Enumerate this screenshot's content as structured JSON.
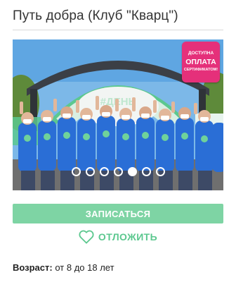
{
  "header": {
    "title": "Путь добра (Клуб \"Кварц\")"
  },
  "gallery": {
    "badge": {
      "line1": "ДОСТУПНА",
      "line2": "ОПЛАТА",
      "line3": "СЕРТИФИКАТОМ!"
    },
    "slide_count": 7,
    "active_slide": 5,
    "banner_text": "#ДЕНЬ"
  },
  "actions": {
    "signup_label": "ЗАПИСАТЬСЯ",
    "later_label": "ОТЛОЖИТЬ"
  },
  "info": {
    "age_label": "Возраст:",
    "age_value": "от 8 до 18 лет"
  },
  "colors": {
    "accent_green": "#7ed4a4",
    "later_green": "#5cc88f",
    "badge_pink": "#e5307a"
  }
}
